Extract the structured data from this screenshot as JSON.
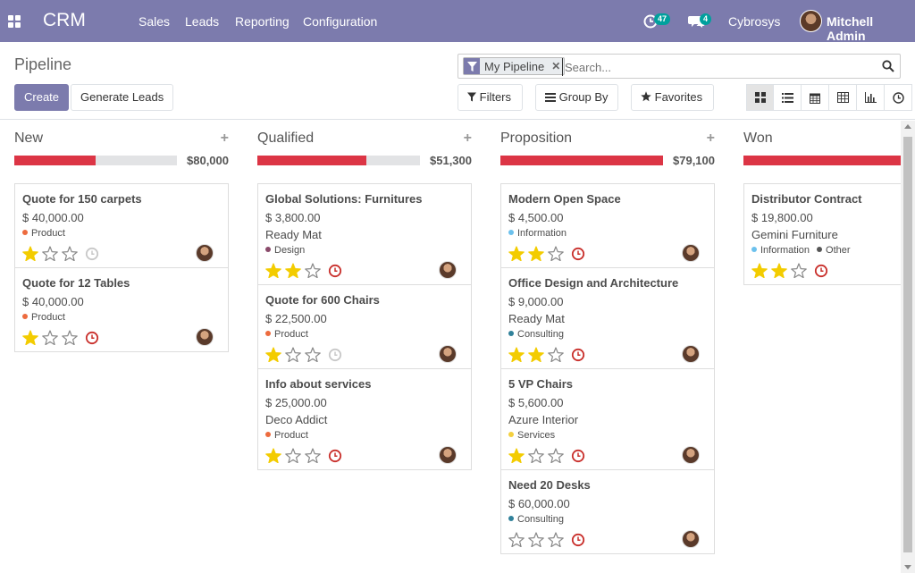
{
  "navbar": {
    "brand": "CRM",
    "menus": [
      "Sales",
      "Leads",
      "Reporting",
      "Configuration"
    ],
    "activity_count": "47",
    "message_count": "4",
    "company": "Cybrosys",
    "user": "Mitchell Admin"
  },
  "control": {
    "breadcrumb": "Pipeline",
    "create_label": "Create",
    "generate_label": "Generate Leads",
    "facet_label": "My Pipeline",
    "search_placeholder": "Search...",
    "filters_label": "Filters",
    "groupby_label": "Group By",
    "favorites_label": "Favorites"
  },
  "colors": {
    "brand": "#7c7bad",
    "progress_red": "#dc3545",
    "star_filled": "#f3cc00",
    "activity_overdue": "#c9302c",
    "tag_product": "#ed6b3e",
    "tag_design": "#8a4a6a",
    "tag_information": "#6cc1ed",
    "tag_consulting": "#30819a",
    "tag_services": "#f4d03f",
    "tag_other": "#555555"
  },
  "columns": [
    {
      "name": "New",
      "total": "$80,000",
      "progress": 0.5,
      "cards": [
        {
          "title": "Quote for 150 carpets",
          "amount": "$ 40,000.00",
          "partner": "",
          "tags": [
            {
              "label": "Product",
              "color": "#ed6b3e"
            }
          ],
          "stars": 1,
          "activity": "none"
        },
        {
          "title": "Quote for 12 Tables",
          "amount": "$ 40,000.00",
          "partner": "",
          "tags": [
            {
              "label": "Product",
              "color": "#ed6b3e"
            }
          ],
          "stars": 1,
          "activity": "due"
        }
      ]
    },
    {
      "name": "Qualified",
      "total": "$51,300",
      "progress": 0.67,
      "cards": [
        {
          "title": "Global Solutions: Furnitures",
          "amount": "$ 3,800.00",
          "partner": "Ready Mat",
          "tags": [
            {
              "label": "Design",
              "color": "#8a4a6a"
            }
          ],
          "stars": 2,
          "activity": "due"
        },
        {
          "title": "Quote for 600 Chairs",
          "amount": "$ 22,500.00",
          "partner": "",
          "tags": [
            {
              "label": "Product",
              "color": "#ed6b3e"
            }
          ],
          "stars": 1,
          "activity": "none"
        },
        {
          "title": "Info about services",
          "amount": "$ 25,000.00",
          "partner": "Deco Addict",
          "tags": [
            {
              "label": "Product",
              "color": "#ed6b3e"
            }
          ],
          "stars": 1,
          "activity": "due"
        }
      ]
    },
    {
      "name": "Proposition",
      "total": "$79,100",
      "progress": 1.0,
      "cards": [
        {
          "title": "Modern Open Space",
          "amount": "$ 4,500.00",
          "partner": "",
          "tags": [
            {
              "label": "Information",
              "color": "#6cc1ed"
            }
          ],
          "stars": 2,
          "activity": "due"
        },
        {
          "title": "Office Design and Architecture",
          "amount": "$ 9,000.00",
          "partner": "Ready Mat",
          "tags": [
            {
              "label": "Consulting",
              "color": "#30819a"
            }
          ],
          "stars": 2,
          "activity": "due"
        },
        {
          "title": "5 VP Chairs",
          "amount": "$ 5,600.00",
          "partner": "Azure Interior",
          "tags": [
            {
              "label": "Services",
              "color": "#f4d03f"
            }
          ],
          "stars": 1,
          "activity": "due"
        },
        {
          "title": "Need 20 Desks",
          "amount": "$ 60,000.00",
          "partner": "",
          "tags": [
            {
              "label": "Consulting",
              "color": "#30819a"
            }
          ],
          "stars": 0,
          "activity": "due"
        }
      ]
    },
    {
      "name": "Won",
      "total": "",
      "progress": 1.0,
      "cards": [
        {
          "title": "Distributor Contract",
          "amount": "$ 19,800.00",
          "partner": "Gemini Furniture",
          "tags": [
            {
              "label": "Information",
              "color": "#6cc1ed"
            },
            {
              "label": "Other",
              "color": "#555555"
            }
          ],
          "stars": 2,
          "activity": "due"
        }
      ]
    }
  ]
}
